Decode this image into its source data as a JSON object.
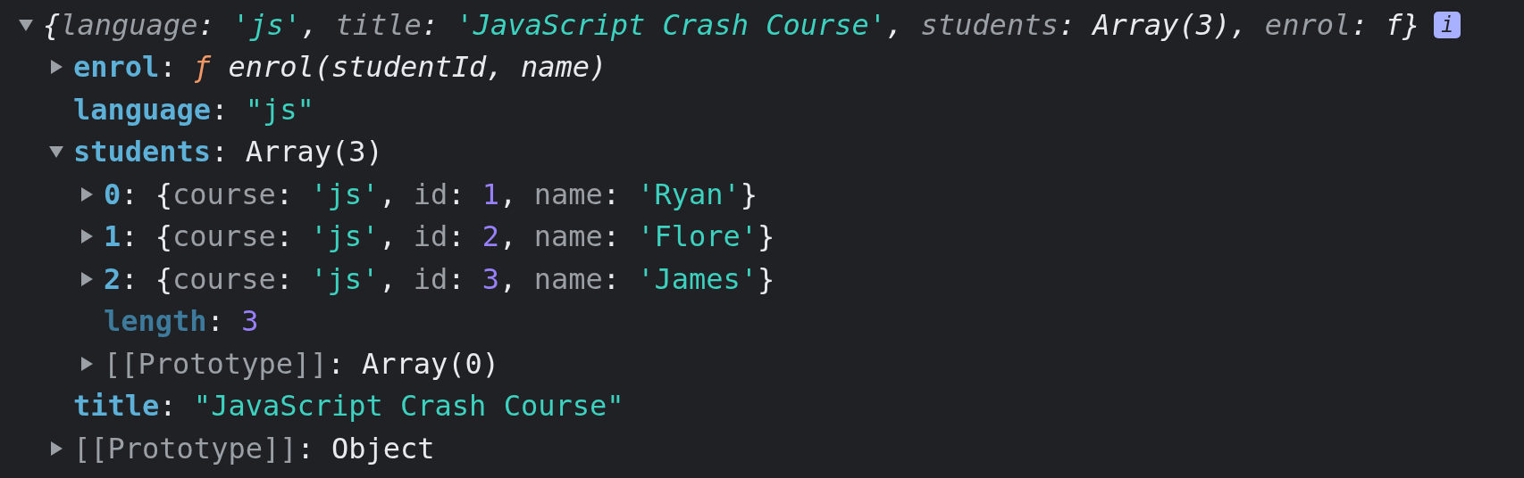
{
  "tree": [
    {
      "kind": "summary",
      "expanded": true,
      "badge": "i",
      "tokens": [
        {
          "text": "{",
          "kind": "punct"
        },
        {
          "text": "language",
          "kind": "preview_key"
        },
        {
          "text": ": ",
          "kind": "punct"
        },
        {
          "text": "'js'",
          "kind": "string"
        },
        {
          "text": ", ",
          "kind": "punct"
        },
        {
          "text": "title",
          "kind": "preview_key"
        },
        {
          "text": ": ",
          "kind": "punct"
        },
        {
          "text": "'JavaScript Crash Course'",
          "kind": "string"
        },
        {
          "text": ", ",
          "kind": "punct"
        },
        {
          "text": "students",
          "kind": "preview_key"
        },
        {
          "text": ": ",
          "kind": "punct"
        },
        {
          "text": "Array(3)",
          "kind": "text"
        },
        {
          "text": ", ",
          "kind": "punct"
        },
        {
          "text": "enrol",
          "kind": "preview_key"
        },
        {
          "text": ": ",
          "kind": "punct"
        },
        {
          "text": "f",
          "kind": "text"
        },
        {
          "text": "}",
          "kind": "punct"
        }
      ],
      "children": [
        {
          "kind": "property",
          "expanded": false,
          "tokens": [
            {
              "text": "enrol",
              "kind": "key"
            },
            {
              "text": ": ",
              "kind": "punct"
            },
            {
              "text": "ƒ",
              "kind": "func"
            },
            {
              "text": " enrol(studentId, name)",
              "kind": "signature"
            }
          ]
        },
        {
          "kind": "property",
          "tokens": [
            {
              "text": "language",
              "kind": "key"
            },
            {
              "text": ": ",
              "kind": "punct"
            },
            {
              "text": "\"js\"",
              "kind": "string"
            }
          ]
        },
        {
          "kind": "property",
          "expanded": true,
          "tokens": [
            {
              "text": "students",
              "kind": "key"
            },
            {
              "text": ": ",
              "kind": "punct"
            },
            {
              "text": "Array(3)",
              "kind": "text"
            }
          ],
          "children": [
            {
              "kind": "property",
              "expanded": false,
              "tokens": [
                {
                  "text": "0",
                  "kind": "key"
                },
                {
                  "text": ": {",
                  "kind": "punct"
                },
                {
                  "text": "course",
                  "kind": "preview_key"
                },
                {
                  "text": ": ",
                  "kind": "punct"
                },
                {
                  "text": "'js'",
                  "kind": "string"
                },
                {
                  "text": ", ",
                  "kind": "punct"
                },
                {
                  "text": "id",
                  "kind": "preview_key"
                },
                {
                  "text": ": ",
                  "kind": "punct"
                },
                {
                  "text": "1",
                  "kind": "number"
                },
                {
                  "text": ", ",
                  "kind": "punct"
                },
                {
                  "text": "name",
                  "kind": "preview_key"
                },
                {
                  "text": ": ",
                  "kind": "punct"
                },
                {
                  "text": "'Ryan'",
                  "kind": "string"
                },
                {
                  "text": "}",
                  "kind": "punct"
                }
              ]
            },
            {
              "kind": "property",
              "expanded": false,
              "tokens": [
                {
                  "text": "1",
                  "kind": "key"
                },
                {
                  "text": ": {",
                  "kind": "punct"
                },
                {
                  "text": "course",
                  "kind": "preview_key"
                },
                {
                  "text": ": ",
                  "kind": "punct"
                },
                {
                  "text": "'js'",
                  "kind": "string"
                },
                {
                  "text": ", ",
                  "kind": "punct"
                },
                {
                  "text": "id",
                  "kind": "preview_key"
                },
                {
                  "text": ": ",
                  "kind": "punct"
                },
                {
                  "text": "2",
                  "kind": "number"
                },
                {
                  "text": ", ",
                  "kind": "punct"
                },
                {
                  "text": "name",
                  "kind": "preview_key"
                },
                {
                  "text": ": ",
                  "kind": "punct"
                },
                {
                  "text": "'Flore'",
                  "kind": "string"
                },
                {
                  "text": "}",
                  "kind": "punct"
                }
              ]
            },
            {
              "kind": "property",
              "expanded": false,
              "tokens": [
                {
                  "text": "2",
                  "kind": "key"
                },
                {
                  "text": ": {",
                  "kind": "punct"
                },
                {
                  "text": "course",
                  "kind": "preview_key"
                },
                {
                  "text": ": ",
                  "kind": "punct"
                },
                {
                  "text": "'js'",
                  "kind": "string"
                },
                {
                  "text": ", ",
                  "kind": "punct"
                },
                {
                  "text": "id",
                  "kind": "preview_key"
                },
                {
                  "text": ": ",
                  "kind": "punct"
                },
                {
                  "text": "3",
                  "kind": "number"
                },
                {
                  "text": ", ",
                  "kind": "punct"
                },
                {
                  "text": "name",
                  "kind": "preview_key"
                },
                {
                  "text": ": ",
                  "kind": "punct"
                },
                {
                  "text": "'James'",
                  "kind": "string"
                },
                {
                  "text": "}",
                  "kind": "punct"
                }
              ]
            },
            {
              "kind": "property",
              "tokens": [
                {
                  "text": "length",
                  "kind": "dim_key"
                },
                {
                  "text": ": ",
                  "kind": "punct"
                },
                {
                  "text": "3",
                  "kind": "number"
                }
              ]
            },
            {
              "kind": "property",
              "expanded": false,
              "tokens": [
                {
                  "text": "[[Prototype]]",
                  "kind": "internal_key"
                },
                {
                  "text": ": ",
                  "kind": "punct"
                },
                {
                  "text": "Array(0)",
                  "kind": "text"
                }
              ]
            }
          ]
        },
        {
          "kind": "property",
          "tokens": [
            {
              "text": "title",
              "kind": "key"
            },
            {
              "text": ": ",
              "kind": "punct"
            },
            {
              "text": "\"JavaScript Crash Course\"",
              "kind": "string"
            }
          ]
        },
        {
          "kind": "property",
          "expanded": false,
          "tokens": [
            {
              "text": "[[Prototype]]",
              "kind": "internal_key"
            },
            {
              "text": ": ",
              "kind": "punct"
            },
            {
              "text": "Object",
              "kind": "text"
            }
          ]
        }
      ]
    }
  ]
}
